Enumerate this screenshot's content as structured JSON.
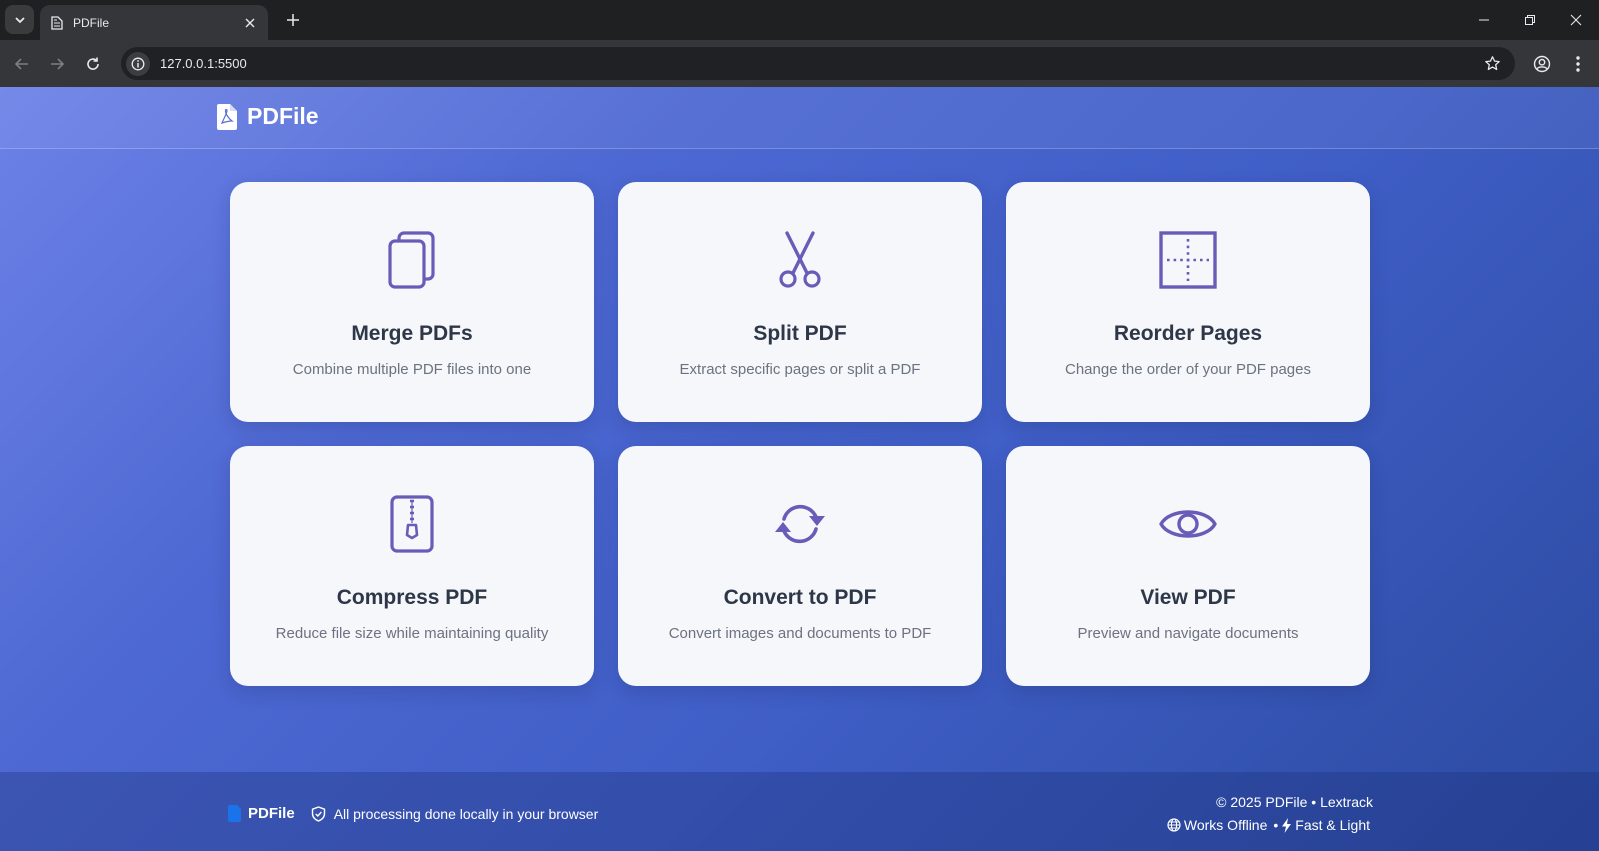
{
  "browser": {
    "tab_title": "PDFile",
    "url": "127.0.0.1:5500"
  },
  "app": {
    "brand": "PDFile"
  },
  "tools": [
    {
      "icon": "copy-icon",
      "title": "Merge PDFs",
      "description": "Combine multiple PDF files into one"
    },
    {
      "icon": "scissors-icon",
      "title": "Split PDF",
      "description": "Extract specific pages or split a PDF"
    },
    {
      "icon": "grid-icon",
      "title": "Reorder Pages",
      "description": "Change the order of your PDF pages"
    },
    {
      "icon": "zip-file-icon",
      "title": "Compress PDF",
      "description": "Reduce file size while maintaining quality"
    },
    {
      "icon": "refresh-icon",
      "title": "Convert to PDF",
      "description": "Convert images and documents to PDF"
    },
    {
      "icon": "eye-icon",
      "title": "View PDF",
      "description": "Preview and navigate documents"
    }
  ],
  "footer": {
    "brand": "PDFile",
    "privacy_note": "All processing done locally in your browser",
    "copyright": "© 2025 PDFile • Lextrack",
    "offline": "Works Offline",
    "separator": "•",
    "speed": "Fast & Light"
  },
  "colors": {
    "accent": "#6b5bb8",
    "card_bg": "#f6f7fb",
    "title_text": "#2d3748",
    "desc_text": "#6b7280"
  }
}
